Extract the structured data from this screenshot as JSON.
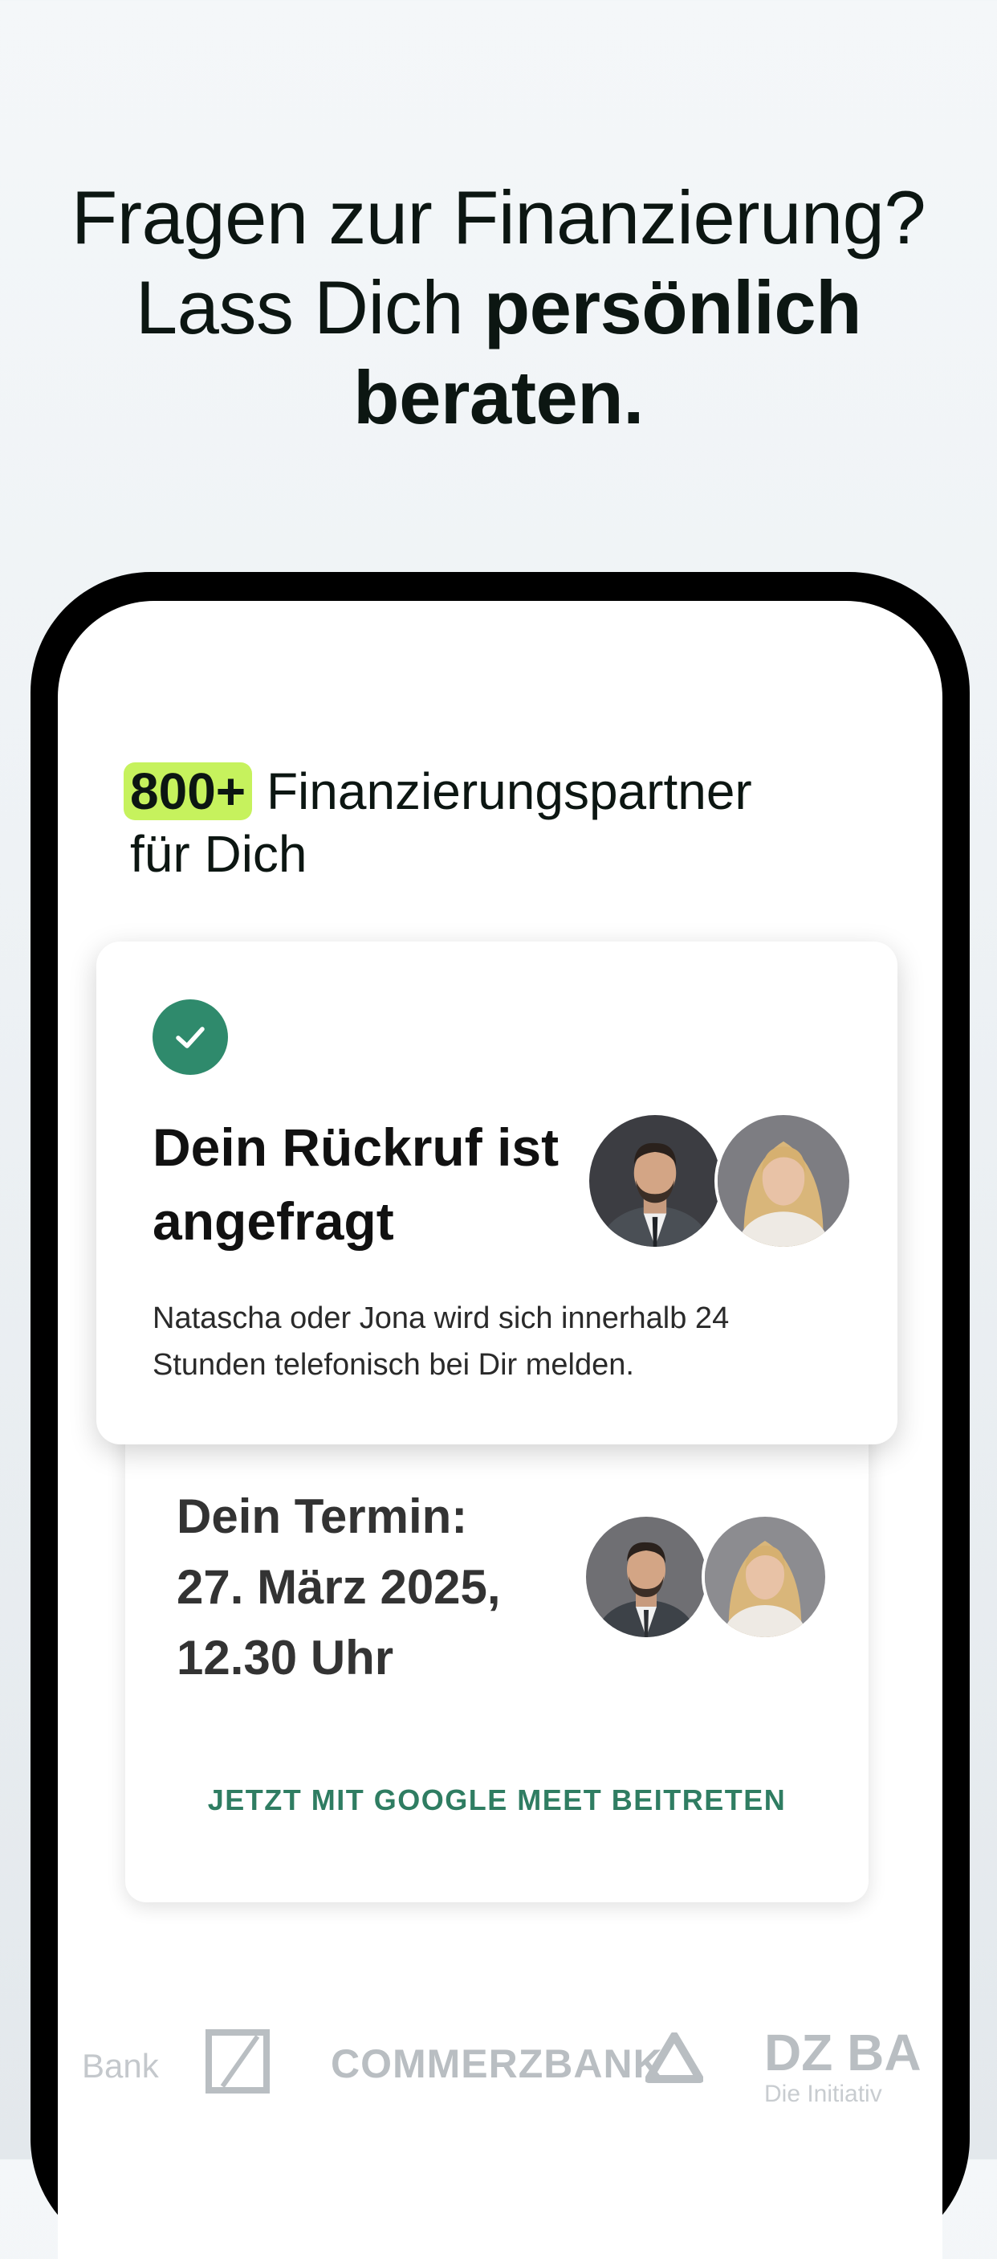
{
  "headline": {
    "line1": "Fragen zur Finanzierung?",
    "line2_regular": "Lass Dich ",
    "line2_bold": "persönlich",
    "line3_bold": "beraten."
  },
  "partners": {
    "count_highlight": "800+",
    "title_rest": " Finanzierungspartner",
    "title_line2": "für Dich"
  },
  "callback_card": {
    "title": "Dein Rückruf ist angefragt",
    "description": "Natascha oder Jona wird sich innerhalb 24 Stunden telefonisch bei Dir melden."
  },
  "appointment_card": {
    "title_line1": "Dein Termin:",
    "title_line2": "27. März 2025,",
    "title_line3": "12.30 Uhr",
    "action_label": "JETZT MIT GOOGLE MEET BEITRETEN"
  },
  "logos": {
    "bank_partial": "Bank",
    "commerzbank": "COMMERZBANK",
    "dz_partial": "DZ BA",
    "dz_sub_partial": "Die Initiativ"
  },
  "colors": {
    "accent_green": "#2f8a6c",
    "highlight_lime": "#c6f25d"
  }
}
